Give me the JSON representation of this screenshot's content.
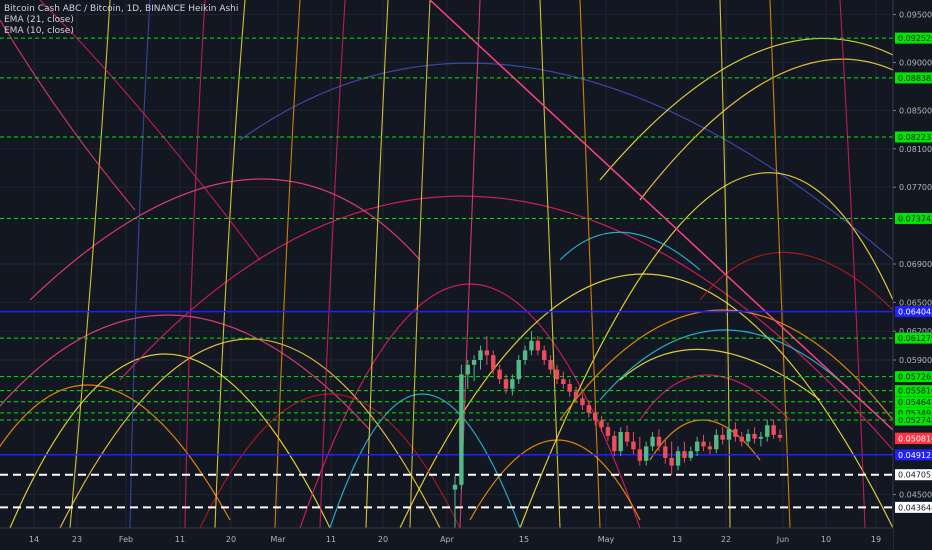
{
  "legend": {
    "title": "Bitcoin Cash ABC / Bitcoin, 1D, BINANCE Heikin Ashi",
    "ema1": "EMA (21, close)",
    "ema2": "EMA (10, close)"
  },
  "chart_data": {
    "type": "candlestick",
    "style": "Heikin Ashi",
    "ylim": [
      0.0415,
      0.0965
    ],
    "yticks": [
      0.095,
      0.09,
      0.085,
      0.081,
      0.077,
      0.069,
      0.065,
      0.062,
      0.059,
      0.045
    ],
    "ytick_labels": [
      "0.095000",
      "0.090000",
      "0.085000",
      "0.081000",
      "0.077000",
      "0.069000",
      "0.065000",
      "0.062000",
      "0.059000",
      "0.045000"
    ],
    "xticks": [
      "14",
      "23",
      "Feb",
      "11",
      "20",
      "Mar",
      "11",
      "20",
      "Apr",
      "15",
      "May",
      "13",
      "22",
      "Jun",
      "10",
      "19"
    ],
    "price_levels": [
      {
        "value": 0.092529,
        "label": "0.092529",
        "color": "#00e600",
        "line": "dashed"
      },
      {
        "value": 0.088385,
        "label": "0.088385",
        "color": "#00e600",
        "line": "dashed"
      },
      {
        "value": 0.082231,
        "label": "0.082231",
        "color": "#00e600",
        "line": "dashed"
      },
      {
        "value": 0.073743,
        "label": "0.073743",
        "color": "#00e600",
        "line": "dashed"
      },
      {
        "value": 0.064043,
        "label": "0.064043",
        "color": "#2121ff",
        "line": "solid"
      },
      {
        "value": 0.061279,
        "label": "0.061279",
        "color": "#00e600",
        "line": "dashed"
      },
      {
        "value": 0.057265,
        "label": "0.057265",
        "color": "#00e600",
        "line": "dashed"
      },
      {
        "value": 0.05581,
        "label": "0.055810",
        "color": "#00e600",
        "line": "dashed"
      },
      {
        "value": 0.054647,
        "label": "0.054647",
        "color": "#00e600",
        "line": "dashed"
      },
      {
        "value": 0.053497,
        "label": "0.053497",
        "color": "#00e600",
        "line": "dashed"
      },
      {
        "value": 0.052748,
        "label": "0.052748",
        "color": "#00e600",
        "line": "dashed"
      },
      {
        "value": 0.049125,
        "label": "0.049125",
        "color": "#2121ff",
        "line": "solid"
      },
      {
        "value": 0.047052,
        "label": "0.047052",
        "color": "#ffffff",
        "line": "dashed-white"
      },
      {
        "value": 0.043648,
        "label": "0.043648",
        "color": "#ffffff",
        "line": "dashed-white"
      }
    ],
    "price_labels": [
      {
        "value": 0.05086,
        "label": "0.050860",
        "color": "#ff3344"
      },
      {
        "value": 0.050816,
        "label": "0.050816",
        "color": "#ff3344"
      }
    ],
    "candles": [
      {
        "o": 0.0455,
        "h": 0.047,
        "l": 0.0415,
        "c": 0.046
      },
      {
        "o": 0.046,
        "h": 0.0585,
        "l": 0.0455,
        "c": 0.0575
      },
      {
        "o": 0.0575,
        "h": 0.059,
        "l": 0.056,
        "c": 0.0585
      },
      {
        "o": 0.0585,
        "h": 0.0595,
        "l": 0.0568,
        "c": 0.059
      },
      {
        "o": 0.059,
        "h": 0.0605,
        "l": 0.058,
        "c": 0.06
      },
      {
        "o": 0.06,
        "h": 0.0615,
        "l": 0.0585,
        "c": 0.0595
      },
      {
        "o": 0.0595,
        "h": 0.06,
        "l": 0.0575,
        "c": 0.058
      },
      {
        "o": 0.058,
        "h": 0.0585,
        "l": 0.0565,
        "c": 0.057
      },
      {
        "o": 0.057,
        "h": 0.0575,
        "l": 0.0555,
        "c": 0.056
      },
      {
        "o": 0.056,
        "h": 0.0575,
        "l": 0.0553,
        "c": 0.057
      },
      {
        "o": 0.057,
        "h": 0.0595,
        "l": 0.0565,
        "c": 0.059
      },
      {
        "o": 0.059,
        "h": 0.0605,
        "l": 0.0585,
        "c": 0.06
      },
      {
        "o": 0.06,
        "h": 0.062,
        "l": 0.0595,
        "c": 0.061
      },
      {
        "o": 0.061,
        "h": 0.0615,
        "l": 0.0595,
        "c": 0.06
      },
      {
        "o": 0.06,
        "h": 0.0605,
        "l": 0.0585,
        "c": 0.059
      },
      {
        "o": 0.059,
        "h": 0.0595,
        "l": 0.0575,
        "c": 0.058
      },
      {
        "o": 0.058,
        "h": 0.0585,
        "l": 0.0565,
        "c": 0.057
      },
      {
        "o": 0.057,
        "h": 0.0578,
        "l": 0.056,
        "c": 0.0565
      },
      {
        "o": 0.0565,
        "h": 0.057,
        "l": 0.0552,
        "c": 0.0557
      },
      {
        "o": 0.0557,
        "h": 0.0562,
        "l": 0.0545,
        "c": 0.055
      },
      {
        "o": 0.055,
        "h": 0.0555,
        "l": 0.0538,
        "c": 0.0543
      },
      {
        "o": 0.0543,
        "h": 0.0548,
        "l": 0.053,
        "c": 0.0535
      },
      {
        "o": 0.0535,
        "h": 0.054,
        "l": 0.0522,
        "c": 0.0527
      },
      {
        "o": 0.0527,
        "h": 0.0532,
        "l": 0.0515,
        "c": 0.052
      },
      {
        "o": 0.052,
        "h": 0.0525,
        "l": 0.0506,
        "c": 0.0511
      },
      {
        "o": 0.0511,
        "h": 0.0516,
        "l": 0.049,
        "c": 0.0495
      },
      {
        "o": 0.0495,
        "h": 0.052,
        "l": 0.049,
        "c": 0.0515
      },
      {
        "o": 0.0515,
        "h": 0.0522,
        "l": 0.05,
        "c": 0.0505
      },
      {
        "o": 0.0505,
        "h": 0.0515,
        "l": 0.0492,
        "c": 0.0497
      },
      {
        "o": 0.0497,
        "h": 0.051,
        "l": 0.048,
        "c": 0.0485
      },
      {
        "o": 0.0485,
        "h": 0.0505,
        "l": 0.048,
        "c": 0.05
      },
      {
        "o": 0.05,
        "h": 0.0515,
        "l": 0.0495,
        "c": 0.051
      },
      {
        "o": 0.051,
        "h": 0.0518,
        "l": 0.0495,
        "c": 0.05
      },
      {
        "o": 0.05,
        "h": 0.0508,
        "l": 0.0482,
        "c": 0.0488
      },
      {
        "o": 0.0488,
        "h": 0.0505,
        "l": 0.047,
        "c": 0.048
      },
      {
        "o": 0.048,
        "h": 0.05,
        "l": 0.0475,
        "c": 0.0495
      },
      {
        "o": 0.0495,
        "h": 0.0505,
        "l": 0.0483,
        "c": 0.0488
      },
      {
        "o": 0.0488,
        "h": 0.05,
        "l": 0.0485,
        "c": 0.0495
      },
      {
        "o": 0.0495,
        "h": 0.051,
        "l": 0.049,
        "c": 0.0505
      },
      {
        "o": 0.0505,
        "h": 0.0512,
        "l": 0.0495,
        "c": 0.05
      },
      {
        "o": 0.05,
        "h": 0.0505,
        "l": 0.0492,
        "c": 0.0497
      },
      {
        "o": 0.0497,
        "h": 0.0518,
        "l": 0.0493,
        "c": 0.0512
      },
      {
        "o": 0.0512,
        "h": 0.052,
        "l": 0.0502,
        "c": 0.0507
      },
      {
        "o": 0.0507,
        "h": 0.0525,
        "l": 0.0502,
        "c": 0.0518
      },
      {
        "o": 0.0518,
        "h": 0.0525,
        "l": 0.0505,
        "c": 0.051
      },
      {
        "o": 0.051,
        "h": 0.0515,
        "l": 0.05,
        "c": 0.0505
      },
      {
        "o": 0.0505,
        "h": 0.0518,
        "l": 0.05,
        "c": 0.0513
      },
      {
        "o": 0.0513,
        "h": 0.052,
        "l": 0.0503,
        "c": 0.0508
      },
      {
        "o": 0.0508,
        "h": 0.0515,
        "l": 0.05,
        "c": 0.051
      },
      {
        "o": 0.051,
        "h": 0.0528,
        "l": 0.0505,
        "c": 0.0522
      },
      {
        "o": 0.0522,
        "h": 0.0528,
        "l": 0.0508,
        "c": 0.0512
      },
      {
        "o": 0.0512,
        "h": 0.0518,
        "l": 0.0505,
        "c": 0.0509
      }
    ],
    "bull_color": "#53b987",
    "bear_color": "#eb4d5c",
    "accent_colors": [
      "#ffeb3b",
      "#ff9800",
      "#e91e63",
      "#26c6da",
      "#3f51b5",
      "#b71c1c",
      "#ffd740",
      "#ff4081"
    ]
  }
}
